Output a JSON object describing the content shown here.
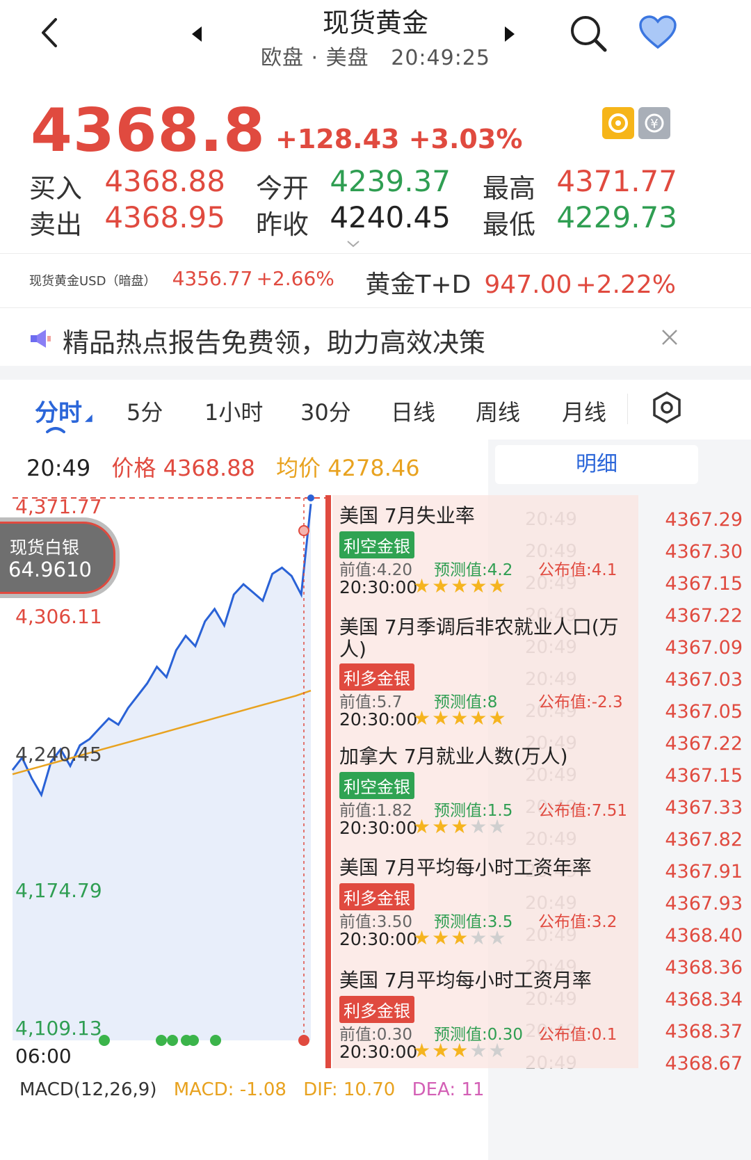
{
  "header": {
    "title": "现货黄金",
    "session": "欧盘 · 美盘",
    "time": "20:49:25"
  },
  "quote": {
    "price": "4368.8",
    "change": "+128.43",
    "change_pct": "+3.03%",
    "buy_label": "买入",
    "buy": "4368.88",
    "sell_label": "卖出",
    "sell": "4368.95",
    "open_label": "今开",
    "open": "4239.37",
    "prev_label": "昨收",
    "prev": "4240.45",
    "high_label": "最高",
    "high": "4371.77",
    "low_label": "最低",
    "low": "4229.73"
  },
  "related": {
    "usd_name": "现货黄金USD（暗盘）",
    "usd_price": "4356.77",
    "usd_pct": "+2.66%",
    "td_name": "黄金T+D",
    "td_price": "947.00",
    "td_pct": "+2.22%"
  },
  "banner": {
    "text": "精品热点报告免费领，助力高效决策"
  },
  "tabs": [
    "分时",
    "5分",
    "1小时",
    "30分",
    "日线",
    "周线",
    "月线"
  ],
  "info_bar": {
    "time": "20:49",
    "price_label": "价格",
    "price": "4368.88",
    "avg_label": "均价",
    "avg": "4278.46",
    "detail_button": "明细"
  },
  "silver_badge": {
    "name": "现货白银",
    "price": "64.9610"
  },
  "chart_axis": {
    "y_labels": [
      "4,371.77",
      "4,306.11",
      "4,240.45",
      "4,174.79",
      "4,109.13"
    ],
    "x_start": "06:00"
  },
  "chart_data": {
    "type": "line",
    "title": "",
    "x_start": "06:00",
    "x_end": "20:49",
    "ylim": [
      4109.13,
      4371.77
    ],
    "series": [
      {
        "values": [
          4240,
          4246,
          4236,
          4228,
          4244,
          4250,
          4242,
          4252,
          4255,
          4260,
          4265,
          4262,
          4270,
          4276,
          4282,
          4290,
          4285,
          4298,
          4305,
          4300,
          4312,
          4318,
          4310,
          4325,
          4330,
          4326,
          4322,
          4335,
          4338,
          4334,
          4325,
          4368.88
        ]
      },
      {
        "values": [
          4238,
          4240,
          4242,
          4244,
          4246,
          4248,
          4250,
          4252,
          4254,
          4256,
          4258,
          4260,
          4262,
          4264,
          4266,
          4268,
          4270,
          4272,
          4274,
          4276,
          4278.46
        ]
      }
    ]
  },
  "events": [
    {
      "title": "美国 7月失业率",
      "tag": "利空金银",
      "tag_type": "bear",
      "prev": "前值:4.20",
      "forecast": "预测值:4.2",
      "actual": "公布值:4.1",
      "time": "20:30:00",
      "stars": 5
    },
    {
      "title": "美国 7月季调后非农就业人口(万人)",
      "tag": "利多金银",
      "tag_type": "bull",
      "prev": "前值:5.7",
      "forecast": "预测值:8",
      "actual": "公布值:-2.3",
      "time": "20:30:00",
      "stars": 5
    },
    {
      "title": "加拿大 7月就业人数(万人)",
      "tag": "利空金银",
      "tag_type": "bear",
      "prev": "前值:1.82",
      "forecast": "预测值:1.5",
      "actual": "公布值:7.51",
      "time": "20:30:00",
      "stars": 3
    },
    {
      "title": "美国 7月平均每小时工资年率",
      "tag": "利多金银",
      "tag_type": "bull",
      "prev": "前值:3.50",
      "forecast": "预测值:3.5",
      "actual": "公布值:3.2",
      "time": "20:30:00",
      "stars": 3
    },
    {
      "title": "美国 7月平均每小时工资月率",
      "tag": "利多金银",
      "tag_type": "bull",
      "prev": "前值:0.30",
      "forecast": "预测值:0.30",
      "actual": "公布值:0.1",
      "time": "20:30:00",
      "stars": 3
    }
  ],
  "ticks": [
    {
      "time": "20:49",
      "price": "4367.29"
    },
    {
      "time": "20:49",
      "price": "4367.30"
    },
    {
      "time": "20:49",
      "price": "4367.15"
    },
    {
      "time": "20:49",
      "price": "4367.22"
    },
    {
      "time": "20:49",
      "price": "4367.09"
    },
    {
      "time": "20:49",
      "price": "4367.03"
    },
    {
      "time": "20:49",
      "price": "4367.05"
    },
    {
      "time": "20:49",
      "price": "4367.22"
    },
    {
      "time": "20:49",
      "price": "4367.15"
    },
    {
      "time": "20:49",
      "price": "4367.33"
    },
    {
      "time": "20:49",
      "price": "4367.82"
    },
    {
      "time": "20:49",
      "price": "4367.91"
    },
    {
      "time": "20:49",
      "price": "4367.93"
    },
    {
      "time": "20:49",
      "price": "4368.40"
    },
    {
      "time": "20:49",
      "price": "4368.36"
    },
    {
      "time": "20:49",
      "price": "4368.34"
    },
    {
      "time": "20:49",
      "price": "4368.37"
    },
    {
      "time": "20:49",
      "price": "4368.67"
    }
  ],
  "bottom": {
    "macd_params": "MACD(12,26,9)",
    "macd": "MACD: -1.08",
    "dif": "DIF: 10.70",
    "dea": "DEA: 11"
  },
  "colors": {
    "red": "#e04a3f",
    "green": "#2f9e52",
    "blue": "#2b66d9",
    "price_line": "#2a62d6",
    "avg_line": "#e8a21f"
  }
}
